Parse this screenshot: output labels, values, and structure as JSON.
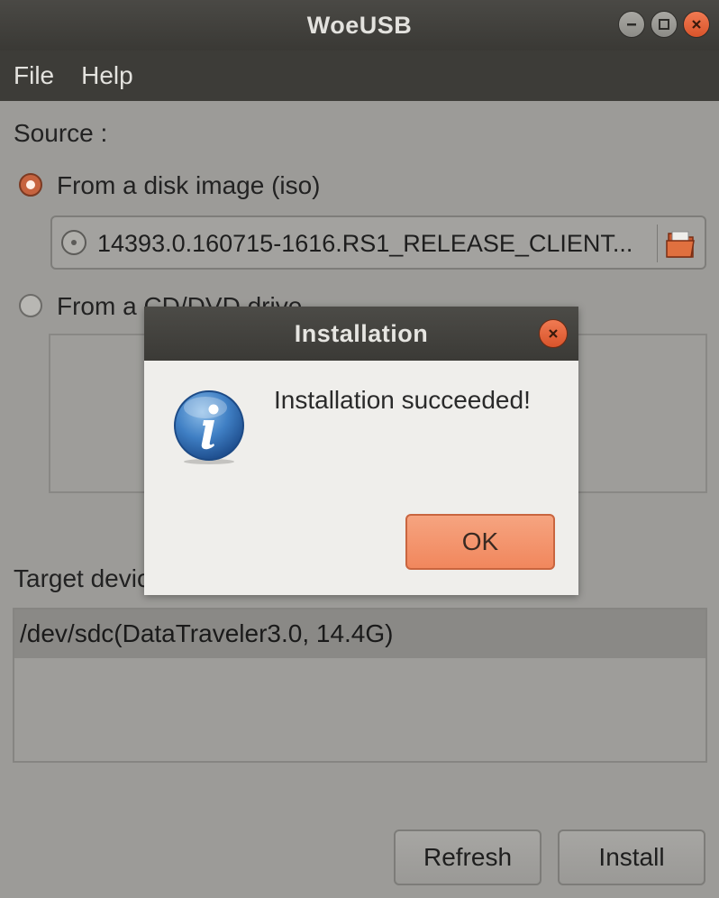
{
  "window": {
    "title": "WoeUSB"
  },
  "menu": {
    "items": [
      "File",
      "Help"
    ]
  },
  "source": {
    "heading": "Source :",
    "disk_image_label": "From a disk image (iso)",
    "disk_image_selected": true,
    "file_name": "14393.0.160715-1616.RS1_RELEASE_CLIENT...",
    "cd_label": "From a CD/DVD drive",
    "cd_selected": false
  },
  "target": {
    "heading": "Target device :",
    "devices": [
      "/dev/sdc(DataTraveler3.0, 14.4G)"
    ]
  },
  "buttons": {
    "refresh": "Refresh",
    "install": "Install"
  },
  "dialog": {
    "title": "Installation",
    "message": "Installation succeeded!",
    "ok": "OK",
    "icon": "info-icon"
  },
  "colors": {
    "accent": "#e95420",
    "titlebar": "#3c3b37",
    "ok_button": "#f39a73"
  }
}
